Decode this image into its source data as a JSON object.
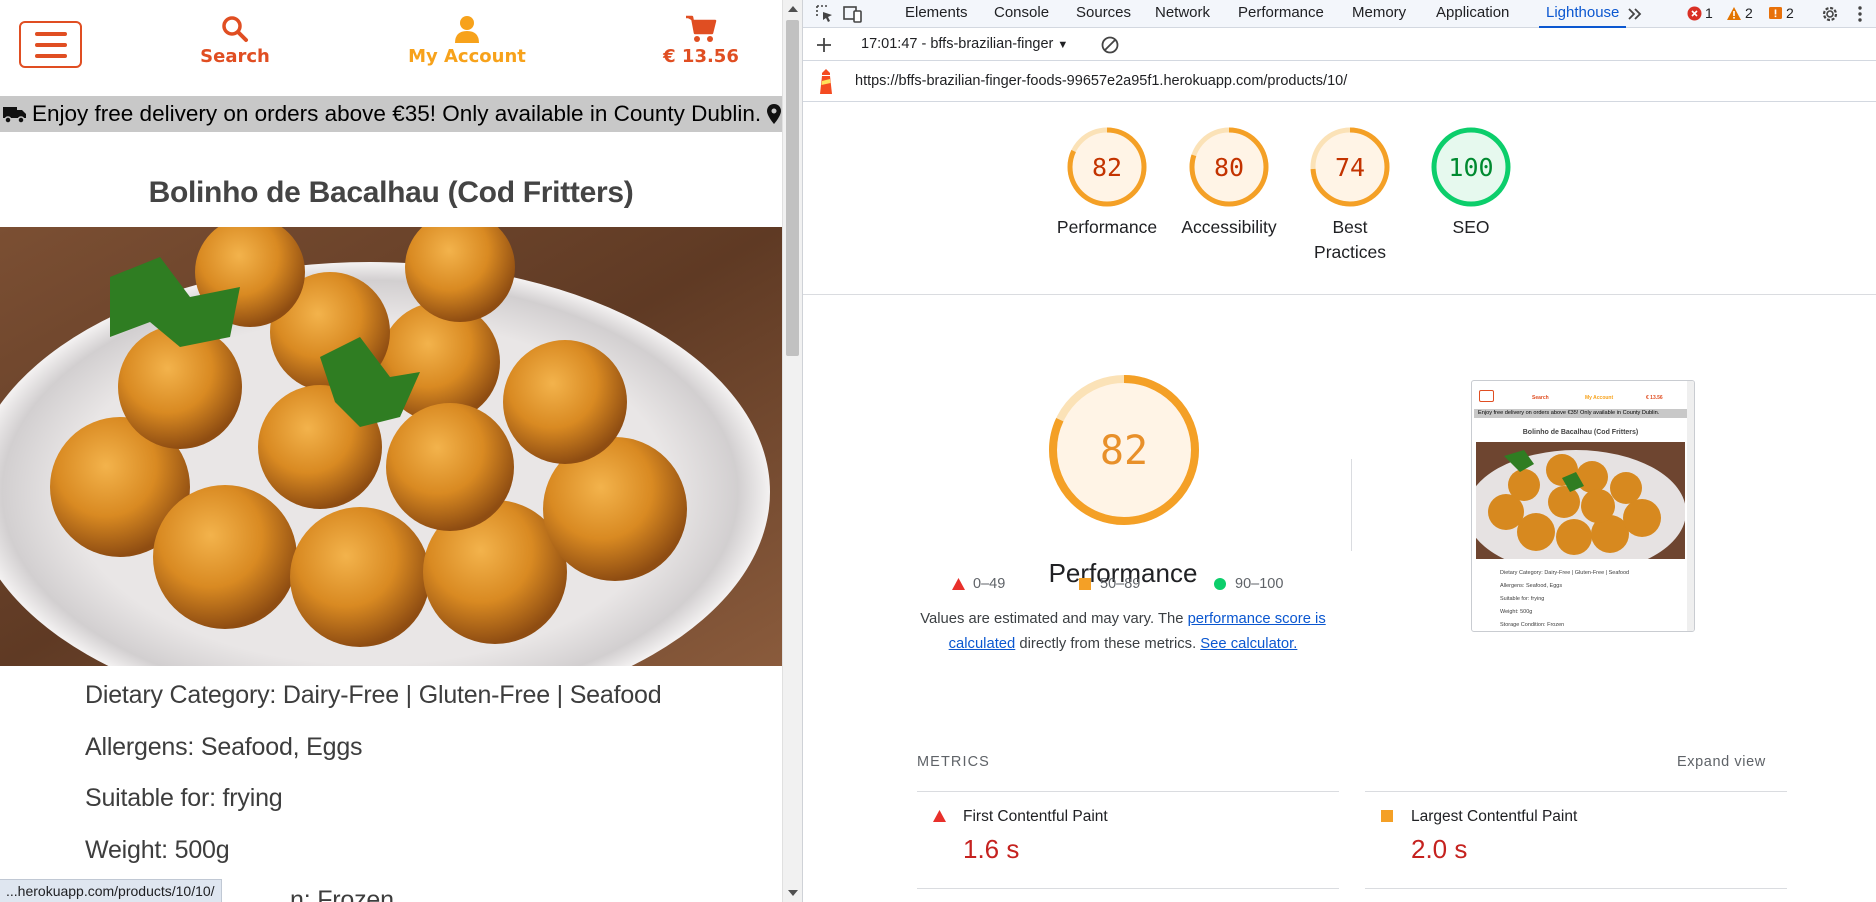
{
  "site": {
    "nav": {
      "search_label": "Search",
      "account_label": "My Account",
      "cart_total": "€ 13.56"
    },
    "banner_text": "Enjoy free delivery on orders above €35! Only available in County Dublin.",
    "product": {
      "title": "Bolinho de Bacalhau (Cod Fritters)",
      "dietary": "Dietary Category: Dairy-Free | Gluten-Free | Seafood",
      "allergens": "Allergens: Seafood, Eggs",
      "suitable": "Suitable for: frying",
      "weight": "Weight: 500g",
      "storage_partial": "n: Frozen"
    },
    "status_url": "...herokuapp.com/products/10/10/"
  },
  "devtools": {
    "tabs": [
      "Elements",
      "Console",
      "Sources",
      "Network",
      "Performance",
      "Memory",
      "Application",
      "Lighthouse"
    ],
    "active_tab": "Lighthouse",
    "issues": {
      "errors": "1",
      "warnings": "2",
      "info": "2"
    },
    "toolbar_session": "17:01:47 - bffs-brazilian-finger",
    "report_url": "https://bffs-brazilian-finger-foods-99657e2a95f1.herokuapp.com/products/10/",
    "scores": [
      {
        "label": "Performance",
        "value": "82",
        "color": "#f4a026"
      },
      {
        "label": "Accessibility",
        "value": "80",
        "color": "#f4a026"
      },
      {
        "label": "Best Practices",
        "value": "74",
        "color": "#f4a026"
      },
      {
        "label": "SEO",
        "value": "100",
        "color": "#0cce6b"
      }
    ],
    "performance": {
      "score": "82",
      "title": "Performance",
      "desc_prefix": "Values are estimated and may vary. The ",
      "desc_link1": "performance score is calculated",
      "desc_middle": " directly from these metrics. ",
      "desc_link2": "See calculator."
    },
    "legend": [
      "0–49",
      "50–89",
      "90–100"
    ],
    "metrics_heading": "METRICS",
    "expand_view": "Expand view",
    "metrics": [
      {
        "name": "First Contentful Paint",
        "value": "1.6 s",
        "rating": "fail"
      },
      {
        "name": "Largest Contentful Paint",
        "value": "2.0 s",
        "rating": "average"
      }
    ],
    "thumbnail": {
      "title": "Bolinho de Bacalhau (Cod Fritters)",
      "banner": "Enjoy free delivery on orders above €35! Only available in County Dublin.",
      "lines": [
        "Dietary Category: Dairy-Free | Gluten-Free | Seafood",
        "Allergens: Seafood, Eggs",
        "Suitable for: frying",
        "Weight: 500g",
        "Storage Condition: Frozen"
      ],
      "nav": [
        "Search",
        "My Account",
        "€ 13.56"
      ]
    }
  },
  "colors": {
    "brand_red": "#e04e22",
    "brand_orange": "#f7a21b",
    "lh_average": "#f4a026",
    "lh_pass": "#0cce6b",
    "lh_fail": "#e8302b",
    "active_tab": "#0b57d0"
  },
  "icons": [
    "hamburger-menu-icon",
    "search-icon",
    "user-icon",
    "cart-icon",
    "truck-icon",
    "map-pin-icon",
    "select-element-icon",
    "device-toolbar-icon",
    "more-tabs-icon",
    "error-icon",
    "warning-icon",
    "info-icon",
    "settings-gear-icon",
    "kebab-menu-icon",
    "add-icon",
    "clear-icon",
    "lighthouse-icon"
  ]
}
